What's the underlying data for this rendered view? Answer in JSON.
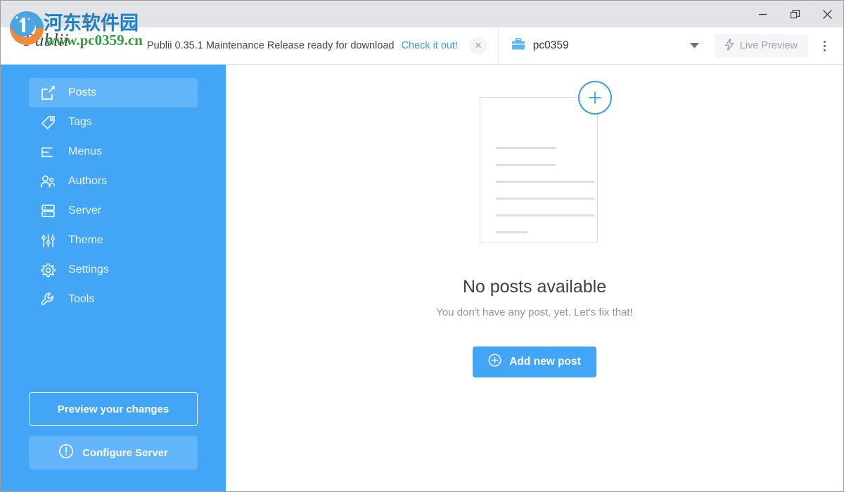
{
  "window": {
    "controls": [
      {
        "name": "minimize",
        "label": "Minimize"
      },
      {
        "name": "restore",
        "label": "Restore"
      },
      {
        "name": "close",
        "label": "Close"
      }
    ]
  },
  "brand": {
    "app_name": "Publii"
  },
  "watermark": {
    "chinese": "河东软件园",
    "url": "www.pc0359.cn",
    "chinese_color": "#1f7ec4",
    "url_color": "#2e9e3e"
  },
  "notification": {
    "message": "Publii 0.35.1 Maintenance Release ready for download",
    "link_label": "Check it out!",
    "link_color": "#3e9bf0",
    "close_icon": "close-icon",
    "close_glyph": "✕"
  },
  "toolbar": {
    "site_icon": "briefcase-icon",
    "site_name": "pc0359",
    "dropdown_icon": "chevron-down-icon",
    "live_preview_label": "Live Preview",
    "live_preview_icon": "lightning-bolt-icon",
    "menu_icon": "kebab-menu-icon"
  },
  "sidebar": {
    "background_color": "#42a5f5",
    "active_color": "#62b5f8",
    "items": [
      {
        "label": "Posts",
        "icon": "edit-square-icon",
        "active": true
      },
      {
        "label": "Tags",
        "icon": "tag-icon",
        "active": false
      },
      {
        "label": "Menus",
        "icon": "list-icon",
        "active": false
      },
      {
        "label": "Authors",
        "icon": "users-icon",
        "active": false
      },
      {
        "label": "Server",
        "icon": "server-icon",
        "active": false
      },
      {
        "label": "Theme",
        "icon": "sliders-icon",
        "active": false
      },
      {
        "label": "Settings",
        "icon": "gear-icon",
        "active": false
      },
      {
        "label": "Tools",
        "icon": "wrench-icon",
        "active": false
      }
    ],
    "preview_button_label": "Preview your changes",
    "configure_button_label": "Configure Server",
    "configure_button_icon": "exclamation-circle-icon"
  },
  "main": {
    "illustration": {
      "name": "empty-document-illustration",
      "plus_icon": "plus-circle-icon",
      "line_widths": [
        85,
        85,
        140,
        140,
        140,
        45
      ]
    },
    "empty_title": "No posts available",
    "empty_subtitle": "You don't have any post, yet. Let's fix that!",
    "add_button_label": "Add new post",
    "add_button_icon": "plus-circle-icon",
    "accent_color": "#42a5f5"
  }
}
